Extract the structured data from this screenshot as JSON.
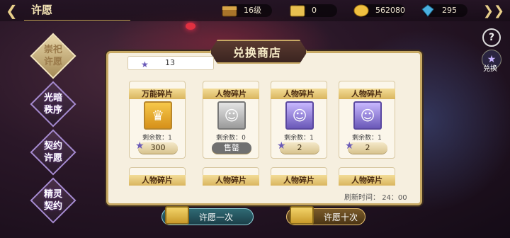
{
  "header": {
    "title": "许愿",
    "level": "16级",
    "cards": "0",
    "gold": "562080",
    "gems": "295"
  },
  "side_menu": [
    {
      "label": "崇祀许愿"
    },
    {
      "label": "光暗秩序"
    },
    {
      "label": "契约许愿"
    },
    {
      "label": "精灵契约"
    }
  ],
  "right_icons": {
    "help": "?",
    "star_label": "兑换"
  },
  "shop": {
    "title": "兑换商店",
    "star_count": "13",
    "refresh_label": "刷新时间：",
    "refresh_time": "24：00",
    "items": [
      {
        "name": "万能碎片",
        "remain": "剩余数：1",
        "price": "300",
        "sold": false,
        "style": "gold"
      },
      {
        "name": "人物碎片",
        "remain": "剩余数：0",
        "price": "售罄",
        "sold": true,
        "style": "gray"
      },
      {
        "name": "人物碎片",
        "remain": "剩余数：1",
        "price": "2",
        "sold": false,
        "style": "purple"
      },
      {
        "name": "人物碎片",
        "remain": "剩余数：1",
        "price": "2",
        "sold": false,
        "style": "purple"
      },
      {
        "name": "人物碎片"
      },
      {
        "name": "人物碎片"
      },
      {
        "name": "人物碎片"
      },
      {
        "name": "人物碎片"
      }
    ]
  },
  "buttons": {
    "wish_one": "许愿一次",
    "wish_ten": "许愿十次"
  }
}
